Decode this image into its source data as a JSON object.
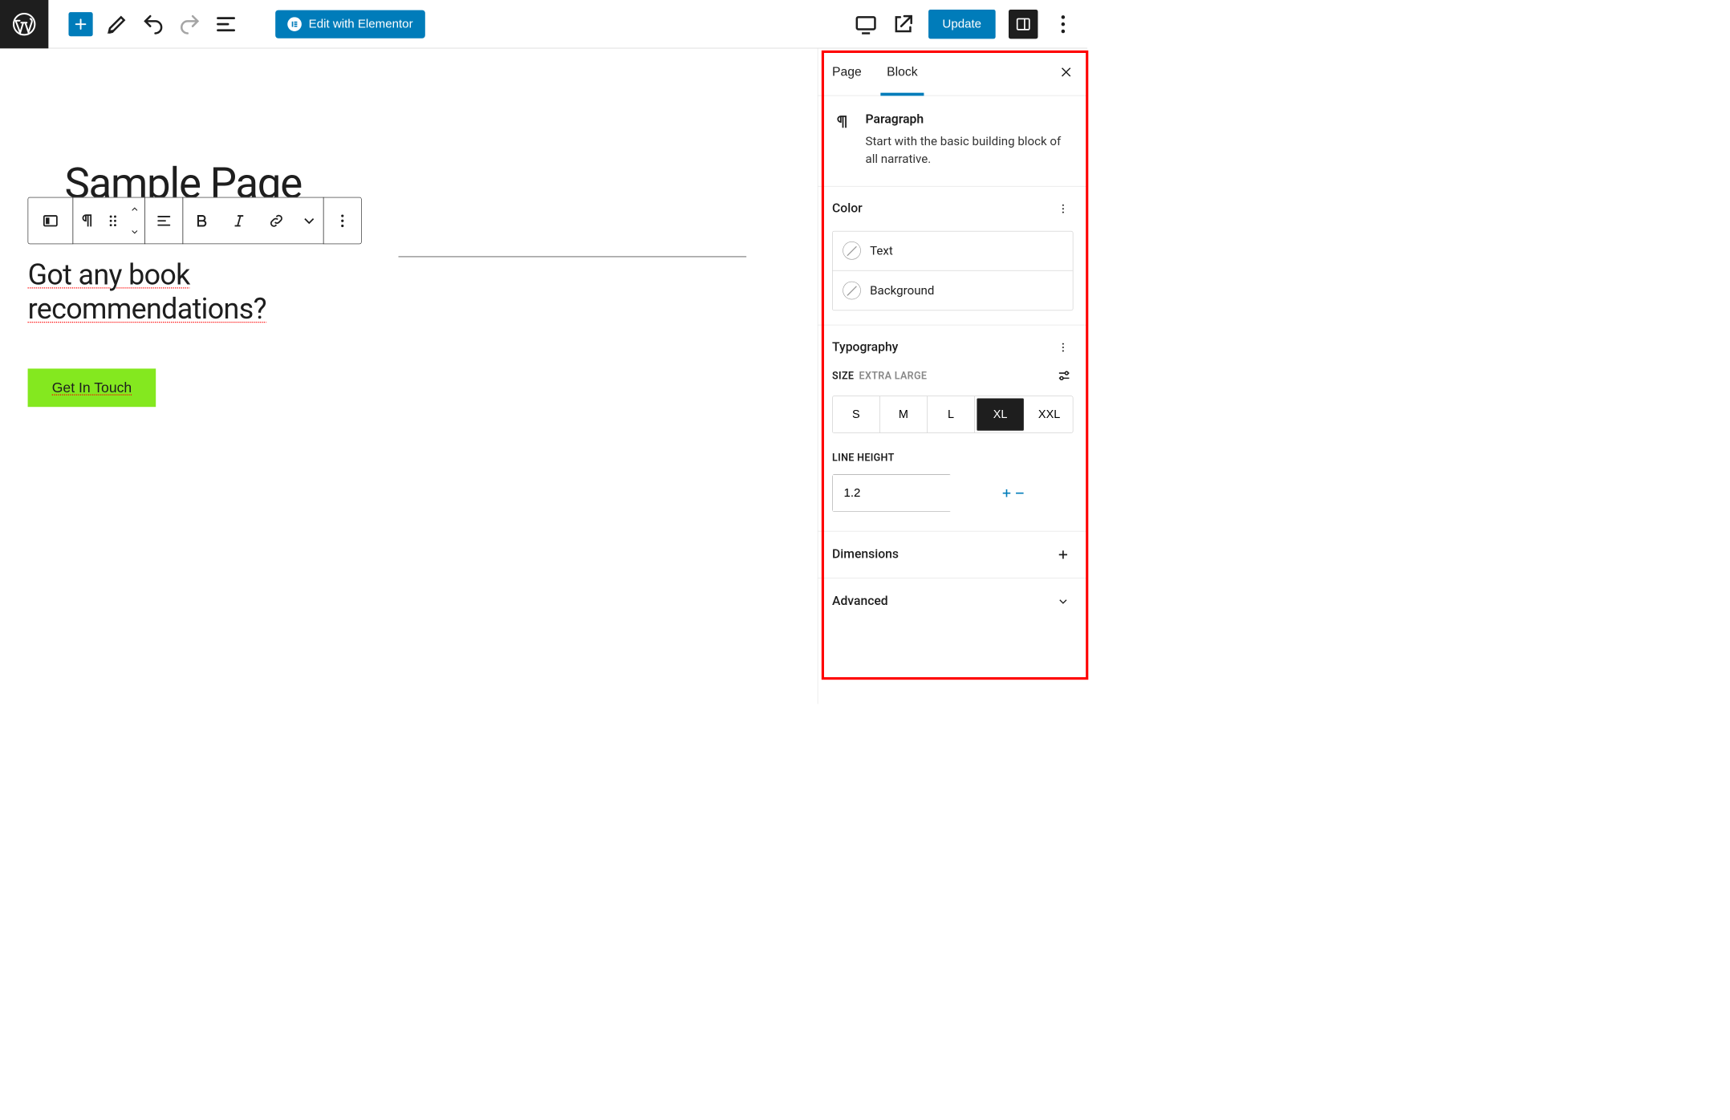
{
  "toolbar": {
    "edit_with_elementor": "Edit with Elementor",
    "update": "Update"
  },
  "page": {
    "title": "Sample Page",
    "paragraph": "Got any book recommendations?",
    "paragraph_line1": "Got any book",
    "paragraph_line2": "recommendations?",
    "button_label": "Get In Touch"
  },
  "sidebar": {
    "tabs": {
      "page": "Page",
      "block": "Block"
    },
    "block": {
      "name": "Paragraph",
      "description": "Start with the basic building block of all narrative."
    },
    "color": {
      "title": "Color",
      "text": "Text",
      "background": "Background"
    },
    "typography": {
      "title": "Typography",
      "size_label": "SIZE",
      "size_value": "EXTRA LARGE",
      "sizes": {
        "s": "S",
        "m": "M",
        "l": "L",
        "xl": "XL",
        "xxl": "XXL"
      },
      "line_height_label": "LINE HEIGHT",
      "line_height": "1.2"
    },
    "dimensions": {
      "title": "Dimensions"
    },
    "advanced": {
      "title": "Advanced"
    }
  }
}
